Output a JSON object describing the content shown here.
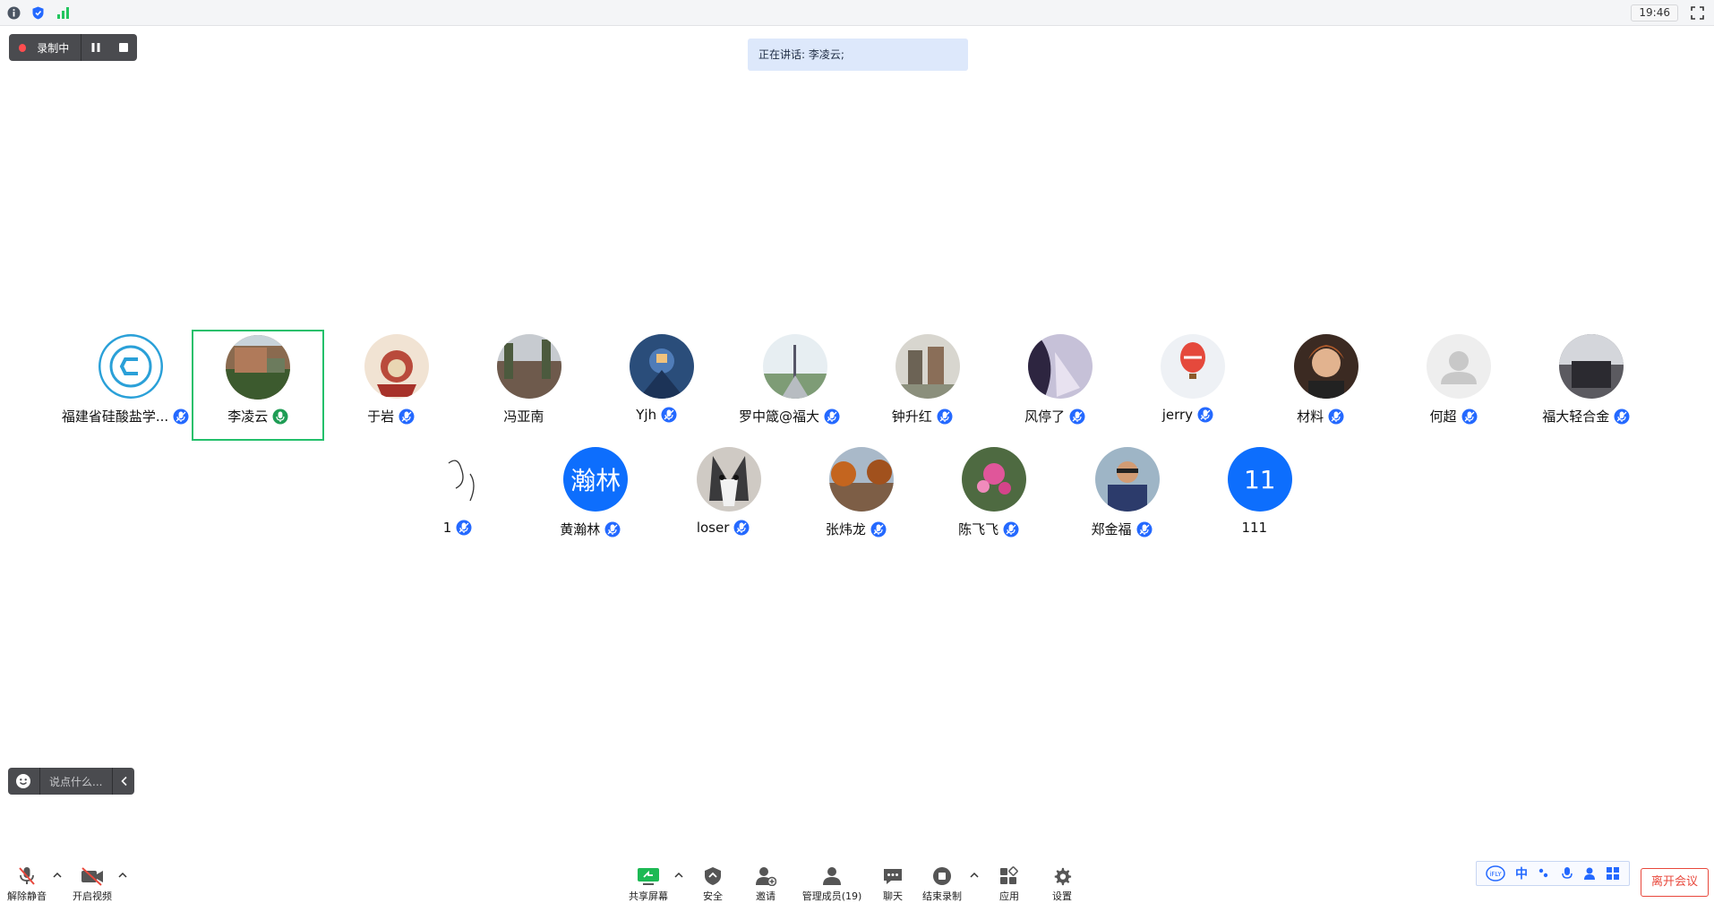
{
  "topbar": {
    "time": "19:46",
    "icons": [
      "info-icon",
      "shield-icon",
      "signal-icon",
      "fullscreen-icon"
    ]
  },
  "recording": {
    "label": "录制中",
    "pause_icon": "pause-icon",
    "stop_icon": "stop-icon"
  },
  "speaking": {
    "text": "正在讲话: 李凌云;"
  },
  "participants_row1": [
    {
      "name": "福建省硅酸盐学...",
      "mic": "mic-icon"
    },
    {
      "name": "李凌云",
      "mic": "mic-speaking-icon",
      "active": true
    },
    {
      "name": "于岩",
      "mic": "mic-icon"
    },
    {
      "name": "冯亚南"
    },
    {
      "name": "Yjh",
      "mic": "mic-icon"
    },
    {
      "name": "罗中箴@福大",
      "mic": "mic-icon"
    },
    {
      "name": "钟升红",
      "mic": "mic-icon"
    },
    {
      "name": "风停了",
      "mic": "mic-icon"
    },
    {
      "name": "jerry",
      "mic": "mic-icon"
    },
    {
      "name": "材料",
      "mic": "mic-icon"
    },
    {
      "name": "何超",
      "mic": "mic-icon"
    },
    {
      "name": "福大轻合金",
      "mic": "mic-icon"
    }
  ],
  "participants_row2": [
    {
      "name": "1",
      "mic": "mic-icon"
    },
    {
      "name": "黄瀚林",
      "mic": "mic-icon",
      "letter": "瀚林"
    },
    {
      "name": "loser",
      "mic": "mic-icon"
    },
    {
      "name": "张炜龙",
      "mic": "mic-icon"
    },
    {
      "name": "陈飞飞",
      "mic": "mic-icon"
    },
    {
      "name": "郑金福",
      "mic": "mic-icon"
    },
    {
      "name": "111",
      "letter": "11"
    }
  ],
  "chat": {
    "placeholder": "说点什么..."
  },
  "toolbar": {
    "unmute": "解除静音",
    "video": "开启视频",
    "share": "共享屏幕",
    "security": "安全",
    "invite": "邀请",
    "members": "管理成员(19)",
    "chat": "聊天",
    "end_record": "结束录制",
    "apps": "应用",
    "settings": "设置"
  },
  "ime": {
    "mode": "中"
  },
  "leave_label": "离开会议",
  "colors": {
    "accent": "#0d6efd",
    "active_border": "#23c06b",
    "leave": "#e8483c",
    "bar_dark": "#4a4b4f"
  }
}
